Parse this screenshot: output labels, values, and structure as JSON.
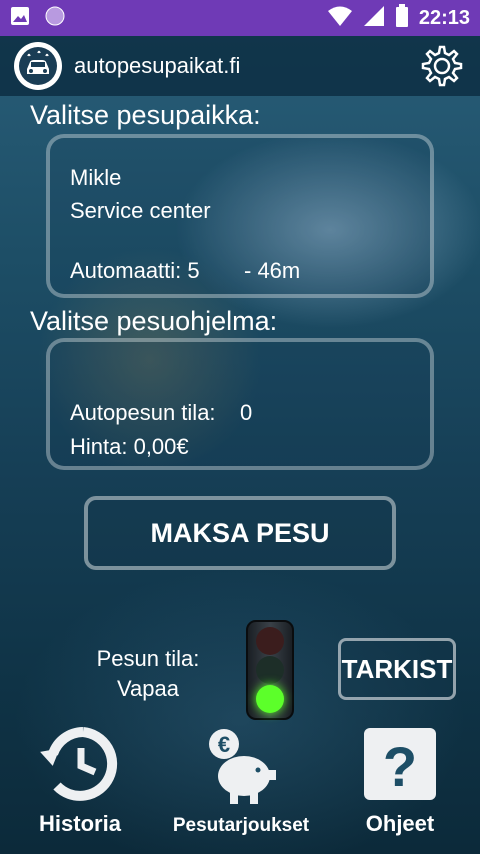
{
  "status_bar": {
    "time": "22:13",
    "icons": [
      "image-icon",
      "circle-icon",
      "wifi-icon",
      "signal-icon",
      "battery-icon"
    ]
  },
  "app_bar": {
    "title": "autopesupaikat.fi",
    "logo_icon": "car-wash-logo-icon",
    "settings_icon": "gear-icon"
  },
  "location": {
    "section_title": "Valitse pesupaikka:",
    "name": "Mikle",
    "subtitle": "Service center",
    "machine_label": "Automaatti: 5",
    "distance": "- 46m"
  },
  "program": {
    "section_title": "Valitse pesuohjelma:",
    "state_label": "Autopesun tila:",
    "state_value": "0",
    "price_label": "Hinta: 0,00€"
  },
  "pay_button": "MAKSA PESU",
  "wash_status": {
    "label": "Pesun tila:",
    "value": "Vapaa",
    "light": "green"
  },
  "check_button": "TARKIST",
  "bottom_nav": [
    {
      "label": "Historia",
      "icon": "history-icon"
    },
    {
      "label": "Pesutarjoukset",
      "icon": "piggy-bank-euro-icon"
    },
    {
      "label": "Ohjeet",
      "icon": "help-icon"
    }
  ],
  "colors": {
    "status_bar": "#6f3ab6",
    "green_light": "#5cff2a"
  }
}
